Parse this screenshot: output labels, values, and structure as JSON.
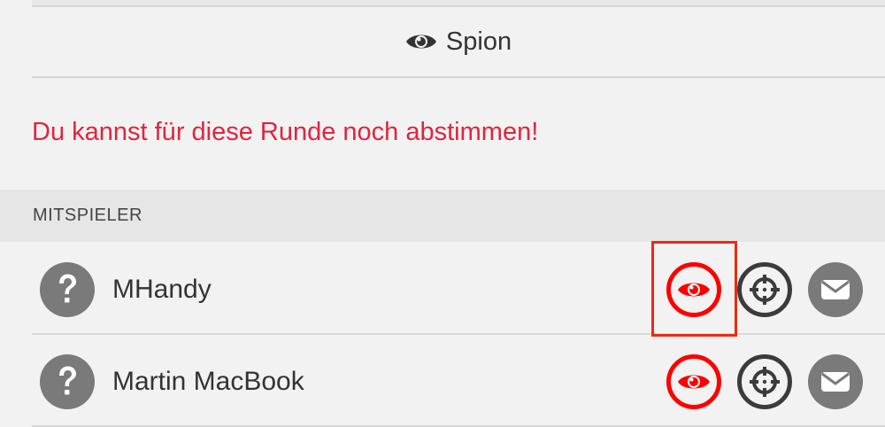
{
  "role": {
    "icon": "eye-icon",
    "label": "Spion"
  },
  "vote_message": "Du kannst für diese Runde noch abstimmen!",
  "section": {
    "title": "MITSPIELER"
  },
  "players": [
    {
      "name": "MHandy",
      "avatar_icon": "question-icon",
      "actions": [
        "eye-icon",
        "crosshair-icon",
        "mail-icon"
      ]
    },
    {
      "name": "Martin MacBook",
      "avatar_icon": "question-icon",
      "actions": [
        "eye-icon",
        "crosshair-icon",
        "mail-icon"
      ]
    }
  ],
  "colors": {
    "accent_red": "#e0243e",
    "icon_red": "#ff0000",
    "highlight_red": "#ee2a10",
    "icon_dark": "#3b3b3b",
    "icon_grey": "#7a7a7a",
    "background": "#f2f2f2",
    "section_bg": "#e6e6e6"
  }
}
